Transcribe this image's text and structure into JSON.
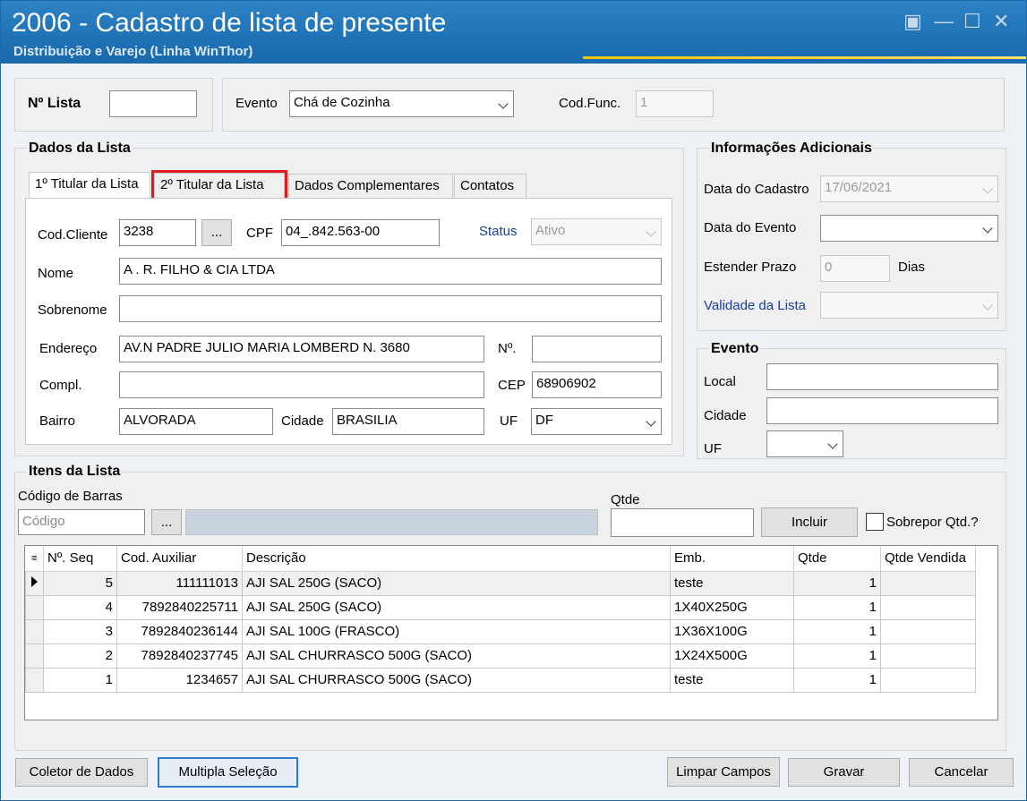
{
  "window": {
    "title": "2006 - Cadastro de lista de presente",
    "subtitle": "Distribuição e Varejo (Linha WinThor)"
  },
  "header": {
    "numero_lista_label": "Nº Lista",
    "numero_lista_value": "",
    "evento_label": "Evento",
    "evento_value": "Chá de Cozinha",
    "cod_func_label": "Cod.Func.",
    "cod_func_value": "1"
  },
  "dados_lista": {
    "title": "Dados da Lista",
    "tabs": [
      {
        "label": "1º Titular da Lista"
      },
      {
        "label": "2º Titular da Lista"
      },
      {
        "label": "Dados Complementares"
      },
      {
        "label": "Contatos"
      }
    ],
    "cod_cliente_label": "Cod.Cliente",
    "cod_cliente_value": "3238",
    "browse_label": "...",
    "cpf_label": "CPF",
    "cpf_value": "04_.842.563-00",
    "status_label": "Status",
    "status_value": "Ativo",
    "nome_label": "Nome",
    "nome_value": "A . R.  FILHO & CIA LTDA",
    "sobrenome_label": "Sobrenome",
    "sobrenome_value": "",
    "endereco_label": "Endereço",
    "endereco_value": "AV.N PADRE  JULIO  MARIA LOMBERD N.  3680",
    "numero_label": "Nº.",
    "numero_value": "",
    "compl_label": "Compl.",
    "compl_value": "",
    "cep_label": "CEP",
    "cep_value": "68906902",
    "bairro_label": "Bairro",
    "bairro_value": "ALVORADA",
    "cidade_label": "Cidade",
    "cidade_value": "BRASILIA",
    "uf_label": "UF",
    "uf_value": "DF"
  },
  "info_adicionais": {
    "title": "Informações Adicionais",
    "data_cadastro_label": "Data do Cadastro",
    "data_cadastro_value": "17/06/2021",
    "data_evento_label": "Data do Evento",
    "data_evento_value": "",
    "estender_prazo_label": "Estender Prazo",
    "estender_prazo_value": "0",
    "dias_label": "Dias",
    "validade_label": "Validade da Lista",
    "validade_value": ""
  },
  "evento_box": {
    "title": "Evento",
    "local_label": "Local",
    "local_value": "",
    "cidade_label": "Cidade",
    "cidade_value": "",
    "uf_label": "UF",
    "uf_value": ""
  },
  "itens": {
    "title": "Itens da Lista",
    "codigo_barras_label": "Código de Barras",
    "codigo_placeholder": "Código",
    "browse_label": "...",
    "qtde_label": "Qtde",
    "incluir_label": "Incluir",
    "sobrepor_label": "Sobrepor Qtd.?",
    "columns": [
      "Nº. Seq",
      "Cod. Auxiliar",
      "Descrição",
      "Emb.",
      "Qtde",
      "Qtde Vendida"
    ],
    "rows": [
      {
        "seq": "5",
        "cod": "111111013",
        "desc": "AJI SAL 250G (SACO)",
        "emb": "teste",
        "qtde": "1",
        "vendida": ""
      },
      {
        "seq": "4",
        "cod": "7892840225711",
        "desc": "AJI SAL 250G (SACO)",
        "emb": "1X40X250G",
        "qtde": "1",
        "vendida": ""
      },
      {
        "seq": "3",
        "cod": "7892840236144",
        "desc": "AJI SAL 100G (FRASCO)",
        "emb": "1X36X100G",
        "qtde": "1",
        "vendida": ""
      },
      {
        "seq": "2",
        "cod": "7892840237745",
        "desc": "AJI SAL CHURRASCO 500G (SACO)",
        "emb": "1X24X500G",
        "qtde": "1",
        "vendida": ""
      },
      {
        "seq": "1",
        "cod": "1234657",
        "desc": "AJI SAL CHURRASCO 500G (SACO)",
        "emb": "teste",
        "qtde": "1",
        "vendida": ""
      }
    ]
  },
  "footer": {
    "coletor_label": "Coletor de Dados",
    "multipla_label": "Multipla Seleção",
    "limpar_label": "Limpar Campos",
    "gravar_label": "Gravar",
    "cancelar_label": "Cancelar"
  },
  "colors": {
    "titlebar": "#1f72b6",
    "accent": "#f5c400",
    "highlight": "#e11b22",
    "link_label": "#1a3e9c"
  }
}
